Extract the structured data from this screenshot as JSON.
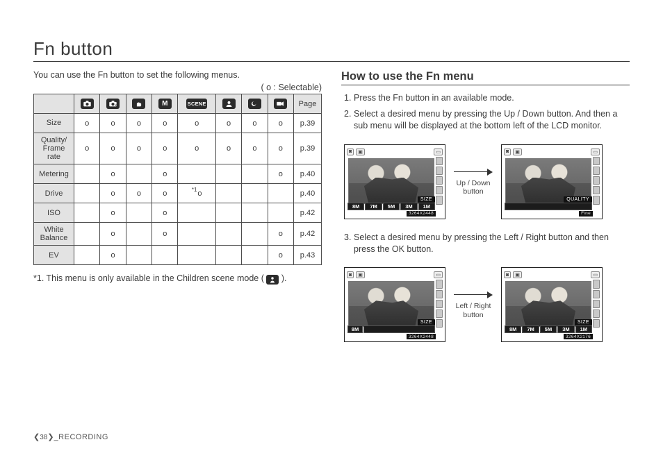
{
  "page_title": "Fn button",
  "intro": "You can use the Fn button to set the following menus.",
  "legend": "( o : Selectable)",
  "table": {
    "mode_icons": [
      "cam",
      "camP",
      "hand",
      "M",
      "SCENE",
      "portrait",
      "night",
      "video"
    ],
    "page_header": "Page",
    "rows": [
      {
        "label": "Size",
        "cells": [
          "o",
          "o",
          "o",
          "o",
          "o",
          "o",
          "o",
          "o"
        ],
        "page": "p.39"
      },
      {
        "label": "Quality/\nFrame rate",
        "cells": [
          "o",
          "o",
          "o",
          "o",
          "o",
          "o",
          "o",
          "o"
        ],
        "page": "p.39"
      },
      {
        "label": "Metering",
        "cells": [
          "",
          "o",
          "",
          "o",
          "",
          "",
          "",
          "o"
        ],
        "page": "p.40"
      },
      {
        "label": "Drive",
        "cells": [
          "",
          "o",
          "o",
          "o",
          "",
          "",
          "",
          ""
        ],
        "page": "p.40",
        "ext_sup": "*1",
        "ext_col": 4
      },
      {
        "label": "ISO",
        "cells": [
          "",
          "o",
          "",
          "o",
          "",
          "",
          "",
          ""
        ],
        "page": "p.42"
      },
      {
        "label": "White\nBalance",
        "cells": [
          "",
          "o",
          "",
          "o",
          "",
          "",
          "",
          "o"
        ],
        "page": "p.42"
      },
      {
        "label": "EV",
        "cells": [
          "",
          "o",
          "",
          "",
          "",
          "",
          "",
          "o"
        ],
        "page": "p.43"
      }
    ]
  },
  "footnote": "*1. This menu is only available in the Children scene mode (",
  "footnote_end": ").",
  "right": {
    "subhead": "How to use the Fn menu",
    "steps": [
      "Press the Fn button in an available mode.",
      "Select a desired menu by pressing the Up / Down button. And then a sub menu will be displayed at the bottom left of the LCD monitor.",
      "Select a desired menu by pressing the Left / Right button and then press the OK button."
    ],
    "arrow1": "Up / Down\nbutton",
    "arrow2": "Left / Right\nbutton",
    "lcd": {
      "label_size": "SIZE",
      "label_quality": "QUALITY",
      "slots_full": [
        "8M",
        "7M",
        "5M",
        "3M",
        "1M"
      ],
      "slot_single": "8M",
      "res_a": "3264X2448",
      "res_b": "Fine",
      "res_c": "3264X2176"
    }
  },
  "footer": {
    "page": "38",
    "section": "_RECORDING"
  }
}
